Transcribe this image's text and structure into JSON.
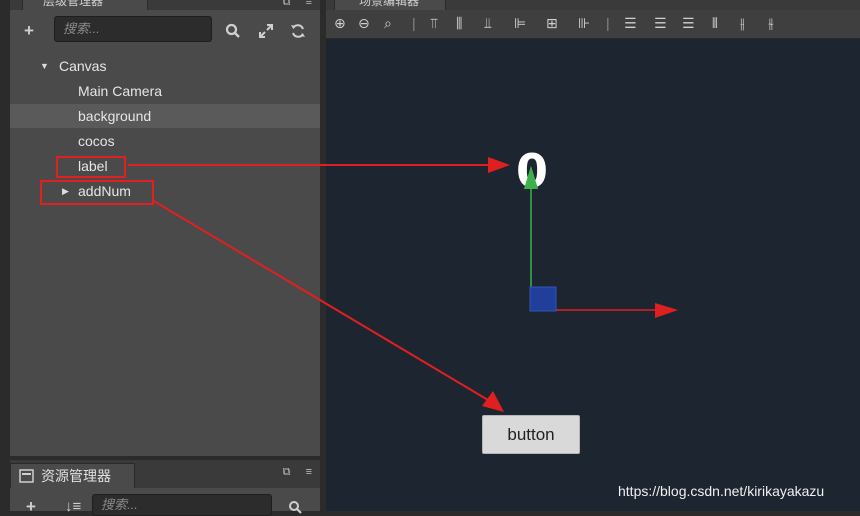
{
  "hierarchy": {
    "tab_label": "层级管理器",
    "search_placeholder": "搜索...",
    "tree": [
      {
        "label": "Canvas"
      },
      {
        "label": "Main Camera"
      },
      {
        "label": "background"
      },
      {
        "label": "cocos"
      },
      {
        "label": "label"
      },
      {
        "label": "addNum"
      }
    ]
  },
  "assets": {
    "tab_label": "资源管理器",
    "search_placeholder": "搜索..."
  },
  "scene": {
    "tab_label": "场景编辑器",
    "label_node_text": "0",
    "button_text": "button"
  },
  "watermark": "https://blog.csdn.net/kirikayakazu",
  "colors": {
    "annotation_red": "#e02020",
    "gizmo_green": "#3cb04a",
    "gizmo_blue": "#1f3f9a",
    "gizmo_red": "#e02020"
  },
  "icons": {
    "add": "plus-icon",
    "search": "search-icon",
    "expand": "expand-icon",
    "refresh": "refresh-icon"
  }
}
